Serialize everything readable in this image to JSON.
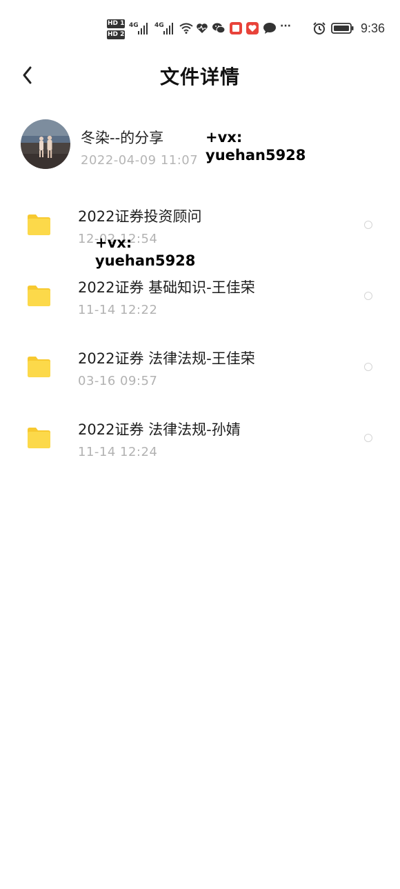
{
  "status_bar": {
    "sim1": "HD 1",
    "sim2": "HD 2",
    "net1": "4G",
    "net2": "4G",
    "more": "···",
    "time": "9:36"
  },
  "header": {
    "title": "文件详情"
  },
  "sharer": {
    "name": "冬染--的分享",
    "time": "2022-04-09  11:07"
  },
  "watermarks": [
    {
      "line1": "+vx:",
      "line2": "yuehan5928"
    },
    {
      "line1": "+vx:",
      "line2": "yuehan5928"
    }
  ],
  "files": [
    {
      "name": "2022证券投资顾问",
      "date": "12-02  12:54"
    },
    {
      "name": "2022证券 基础知识-王佳荣",
      "date": "11-14  12:22"
    },
    {
      "name": "2022证券 法律法规-王佳荣",
      "date": "03-16  09:57"
    },
    {
      "name": "2022证券 法律法规-孙婧",
      "date": "11-14  12:24"
    }
  ],
  "colors": {
    "folder": "#fcd94a",
    "folder_tab": "#f7c930",
    "secondary_text": "#b2b2b2"
  }
}
